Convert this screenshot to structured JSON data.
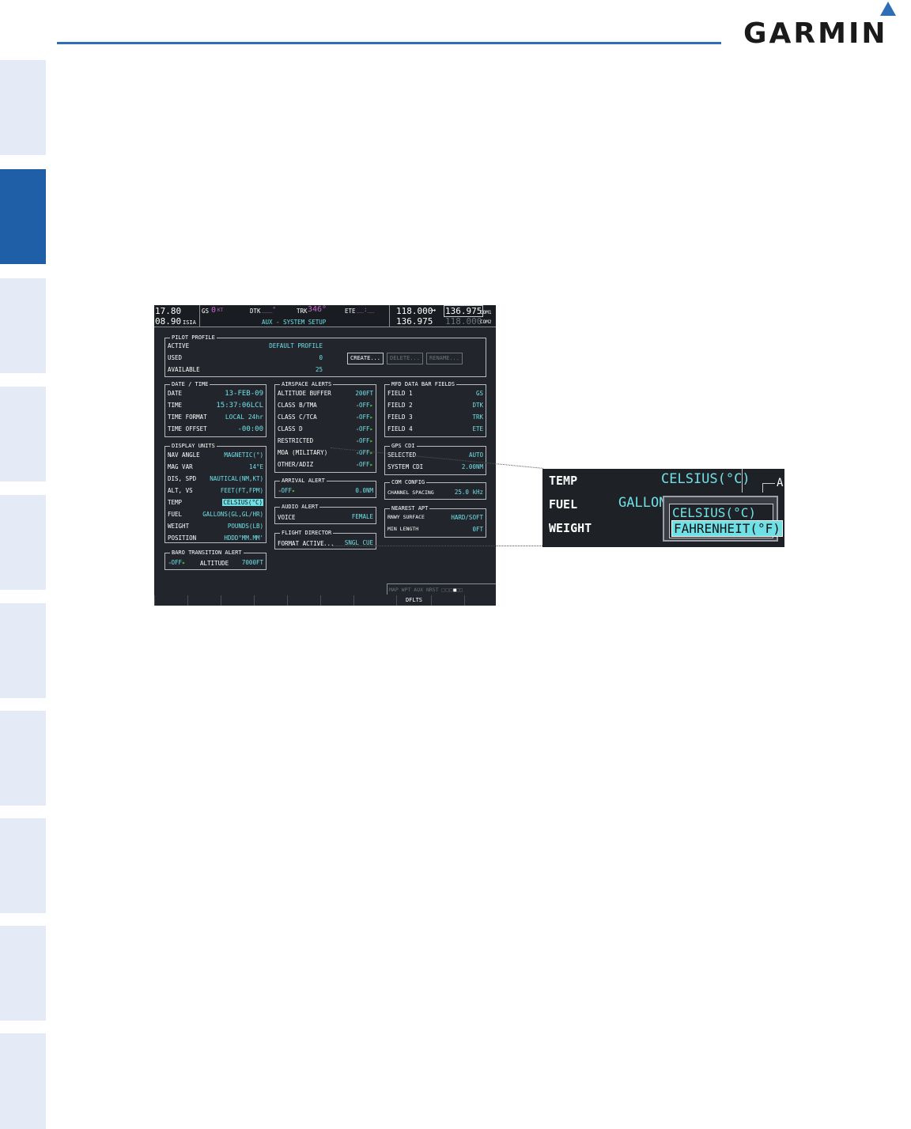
{
  "sidebar": {
    "tabs": [
      "",
      "",
      "",
      "",
      "",
      "",
      "",
      "",
      "",
      "",
      ""
    ],
    "active_index": 1
  },
  "brand": {
    "logo": "GARMIN",
    "accent": "#2f6db5"
  },
  "header": {
    "nav_active": "17.80",
    "nav_standby": "08.90",
    "nav_ident": "ISIA",
    "gs_label": "GS",
    "gs_value": "0",
    "gs_unit": "KT",
    "dtk_label": "DTK",
    "dtk_value": "___°",
    "trk_label": "TRK",
    "trk_value": "346°",
    "ete_label": "ETE",
    "ete_value": "__:__",
    "page_title": "AUX - SYSTEM SETUP",
    "com1_active": "118.000",
    "com1_arrow": "↔",
    "com1_standby": "136.975",
    "com1_label": "COM1",
    "com2_active": "136.975",
    "com2_standby": "118.000",
    "com2_label": "COM2"
  },
  "pilot_profile": {
    "title": "PILOT PROFILE",
    "rows": [
      {
        "label": "ACTIVE",
        "value": "DEFAULT PROFILE"
      },
      {
        "label": "USED",
        "value": "0"
      },
      {
        "label": "AVAILABLE",
        "value": "25"
      }
    ],
    "buttons": {
      "create": "CREATE...",
      "delete": "DELETE...",
      "rename": "RENAME..."
    }
  },
  "date_time": {
    "title": "DATE / TIME",
    "rows": [
      {
        "label": "DATE",
        "value": "13-FEB-09"
      },
      {
        "label": "TIME",
        "value": "15:37:06LCL"
      },
      {
        "label": "TIME FORMAT",
        "value": "LOCAL 24hr"
      },
      {
        "label": "TIME OFFSET",
        "value": "-00:00"
      }
    ]
  },
  "display_units": {
    "title": "DISPLAY UNITS",
    "rows": [
      {
        "label": "NAV ANGLE",
        "value": "MAGNETIC(°)"
      },
      {
        "label": "MAG VAR",
        "value": "14°E"
      },
      {
        "label": "DIS, SPD",
        "value": "NAUTICAL(NM,KT)"
      },
      {
        "label": "ALT, VS",
        "value": "FEET(FT,FPM)"
      },
      {
        "label": "TEMP",
        "value": "CELSIUS(°C)"
      },
      {
        "label": "FUEL",
        "value": "GALLONS(GL,GL/HR)"
      },
      {
        "label": "WEIGHT",
        "value": "POUNDS(LB)"
      },
      {
        "label": "POSITION",
        "value": "HDDD°MM.MM'"
      }
    ]
  },
  "baro_alert": {
    "title": "BARO TRANSITION ALERT",
    "state": "OFF",
    "alt_label": "ALTITUDE",
    "alt_value": "7000FT"
  },
  "airspace_alerts": {
    "title": "AIRSPACE ALERTS",
    "rows": [
      {
        "label": "ALTITUDE BUFFER",
        "value": "200FT"
      },
      {
        "label": "CLASS B/TMA",
        "value": "OFF"
      },
      {
        "label": "CLASS C/TCA",
        "value": "OFF"
      },
      {
        "label": "CLASS D",
        "value": "OFF"
      },
      {
        "label": "RESTRICTED",
        "value": "OFF"
      },
      {
        "label": "MOA (MILITARY)",
        "value": "OFF"
      },
      {
        "label": "OTHER/ADIZ",
        "value": "OFF"
      }
    ]
  },
  "arrival_alert": {
    "title": "ARRIVAL ALERT",
    "state": "OFF",
    "value": "0.0NM"
  },
  "audio_alert": {
    "title": "AUDIO ALERT",
    "label": "VOICE",
    "value": "FEMALE"
  },
  "flight_director": {
    "title": "FLIGHT DIRECTOR",
    "label": "FORMAT ACTIVE",
    "value": "SNGL CUE"
  },
  "mfd_fields": {
    "title": "MFD DATA BAR FIELDS",
    "rows": [
      {
        "label": "FIELD 1",
        "value": "GS"
      },
      {
        "label": "FIELD 2",
        "value": "DTK"
      },
      {
        "label": "FIELD 3",
        "value": "TRK"
      },
      {
        "label": "FIELD 4",
        "value": "ETE"
      }
    ]
  },
  "gps_cdi": {
    "title": "GPS CDI",
    "rows": [
      {
        "label": "SELECTED",
        "value": "AUTO"
      },
      {
        "label": "SYSTEM CDI",
        "value": "2.00NM"
      }
    ]
  },
  "com_config": {
    "title": "COM CONFIG",
    "label": "CHANNEL SPACING",
    "value": "25.0 kHz"
  },
  "nearest_apt": {
    "title": "NEAREST APT",
    "rows": [
      {
        "label": "RNWY SURFACE",
        "value": "HARD/SOFT"
      },
      {
        "label": "MIN LENGTH",
        "value": "0FT"
      }
    ]
  },
  "page_group": {
    "label": "MAP WPT AUX NRST"
  },
  "softkeys": [
    "",
    "",
    "",
    "",
    "",
    "",
    "",
    "DFLTS",
    "",
    ""
  ],
  "zoom": {
    "temp_label": "TEMP",
    "temp_value": "CELSIUS(°C)",
    "fuel_label": "FUEL",
    "fuel_value": "GALLON",
    "weight_label": "WEIGHT",
    "options": [
      "CELSIUS(°C)",
      "FAHRENHEIT(°F)"
    ],
    "selected_option": "FAHRENHEIT(°F)",
    "corner_text": "A"
  }
}
